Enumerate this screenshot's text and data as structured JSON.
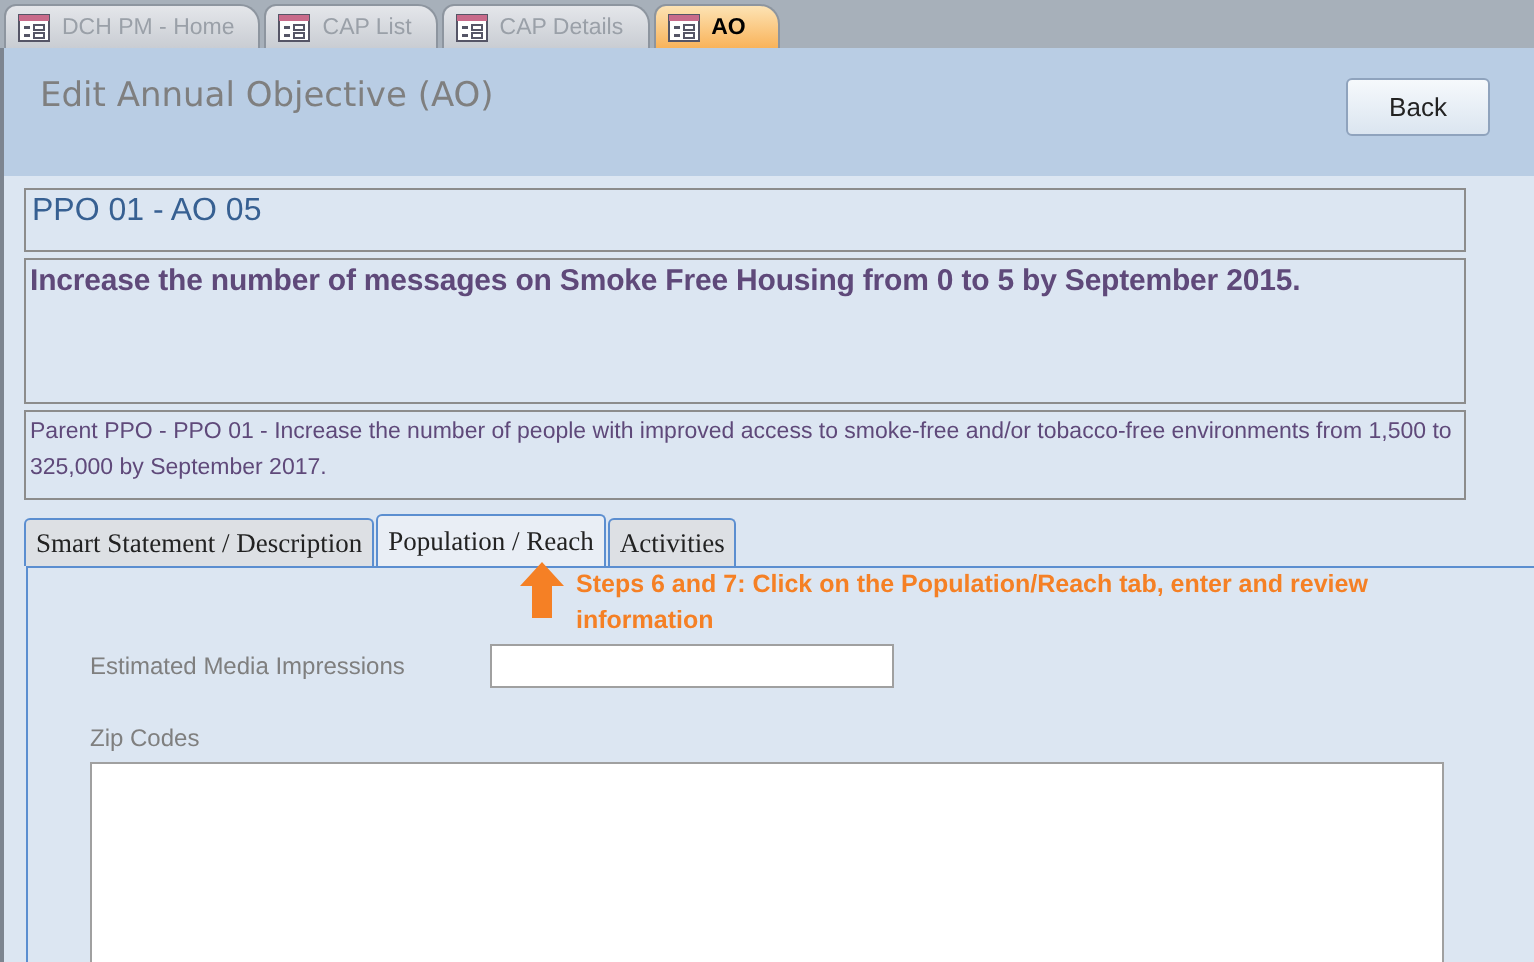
{
  "document_tabs": [
    {
      "label": "DCH PM - Home",
      "selected": false
    },
    {
      "label": "CAP List",
      "selected": false
    },
    {
      "label": "CAP Details",
      "selected": false
    },
    {
      "label": "AO",
      "selected": true
    }
  ],
  "form": {
    "title": "Edit Annual Objective (AO)",
    "back_button": "Back"
  },
  "objective": {
    "code": "PPO 01 - AO 05",
    "statement": "Increase the number of messages on Smoke Free Housing  from 0 to 5 by September 2015.",
    "parent": "Parent PPO - PPO 01 - Increase the number of people with improved access to smoke-free and/or tobacco-free environments from 1,500 to 325,000 by September 2017."
  },
  "tabs": [
    {
      "label": "Smart Statement / Description",
      "selected": false
    },
    {
      "label": "Population / Reach",
      "selected": true
    },
    {
      "label": "Activities",
      "selected": false
    }
  ],
  "callout": "Steps 6 and 7: Click on the Population/Reach tab, enter and review information",
  "fields": [
    {
      "label": "Estimated Media Impressions",
      "kind": "input"
    },
    {
      "label": "Zip Codes",
      "kind": "textarea"
    }
  ]
}
